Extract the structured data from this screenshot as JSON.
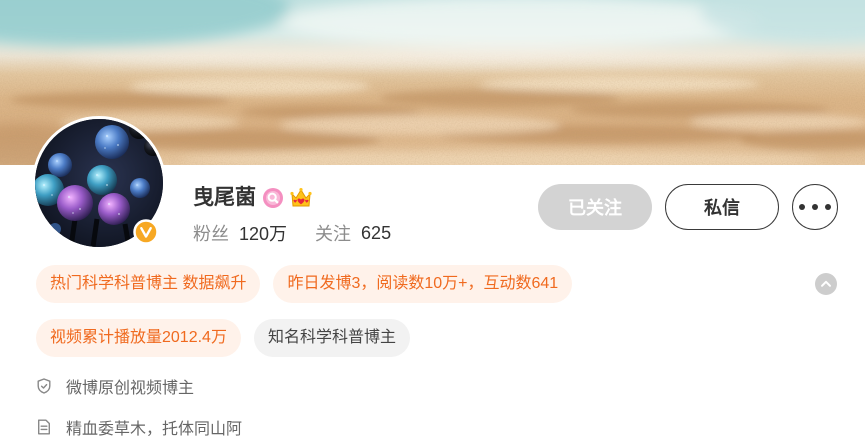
{
  "profile": {
    "name": "曳尾菌",
    "followers": {
      "label": "粉丝",
      "count": "120万"
    },
    "following": {
      "label": "关注",
      "count": "625"
    }
  },
  "actions": {
    "followed_label": "已关注",
    "message_label": "私信"
  },
  "tag_rows": [
    [
      {
        "text": "热门科学科普博主 数据飙升",
        "color": "#f06a1f",
        "background": "#fff2ea"
      },
      {
        "text": "昨日发博3，阅读数10万+，互动数641",
        "color": "#f06a1f",
        "background": "#fff2ea"
      }
    ],
    [
      {
        "text": "视频累计播放量2012.4万",
        "color": "#f06a1f",
        "background": "#fff2ea"
      },
      {
        "text": "知名科学科普博主",
        "color": "#444444",
        "background": "#f2f2f2"
      }
    ]
  ],
  "info": [
    {
      "icon": "shield-icon",
      "text": "微博原创视频博主"
    },
    {
      "icon": "document-icon",
      "text": "精血委草木，托体同山阿"
    }
  ],
  "icons": {
    "avatar": "slime-mold-avatar-image",
    "verified": "verified-v-icon",
    "name_badge_1": "magnifier-badge-icon",
    "name_badge_2": "crown-heart-icon",
    "more": "more-dots-icon",
    "collapse": "chevron-up-icon"
  },
  "colors": {
    "accent_orange": "#f06a1f",
    "accent_orange_bg": "#fff2ea",
    "verified_orange": "#f7a823",
    "followed_button_bg": "#d3d3d3",
    "text_primary": "#333333",
    "text_secondary": "#8c8c8c"
  }
}
